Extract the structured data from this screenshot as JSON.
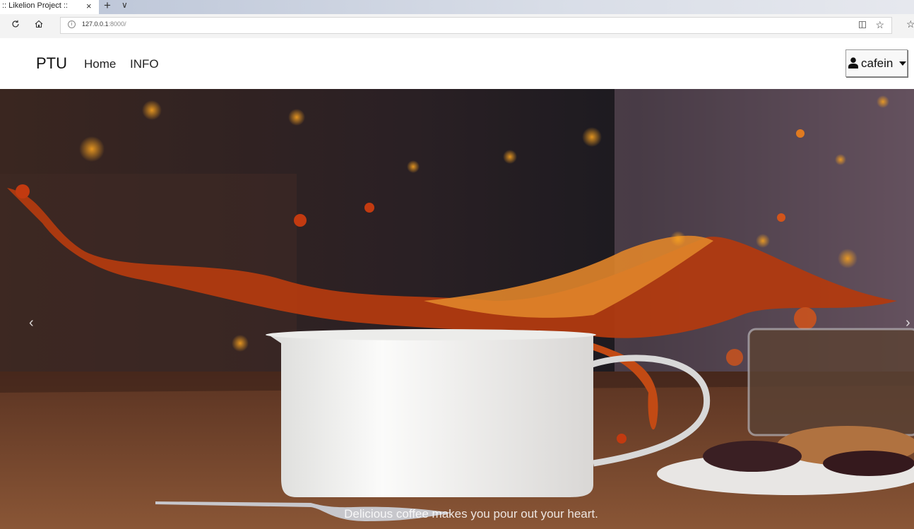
{
  "browser": {
    "tab_title": ":: Likelion Project ::",
    "tab_close": "×",
    "new_tab": "+",
    "tab_menu": "∨",
    "url_host": "127.0.0.1",
    "url_rest": ":8000/",
    "refresh_icon": "refresh-icon",
    "home_icon": "home-icon"
  },
  "navbar": {
    "brand": "PTU",
    "links": [
      "Home",
      "INFO"
    ],
    "user": "cafein"
  },
  "hero": {
    "caption": "Delicious coffee makes you pour out your heart.",
    "prev": "‹",
    "next": "›"
  },
  "colors": {
    "coffee": "#b8360e",
    "cup": "#f2f2f0",
    "table": "#6b3b22"
  }
}
